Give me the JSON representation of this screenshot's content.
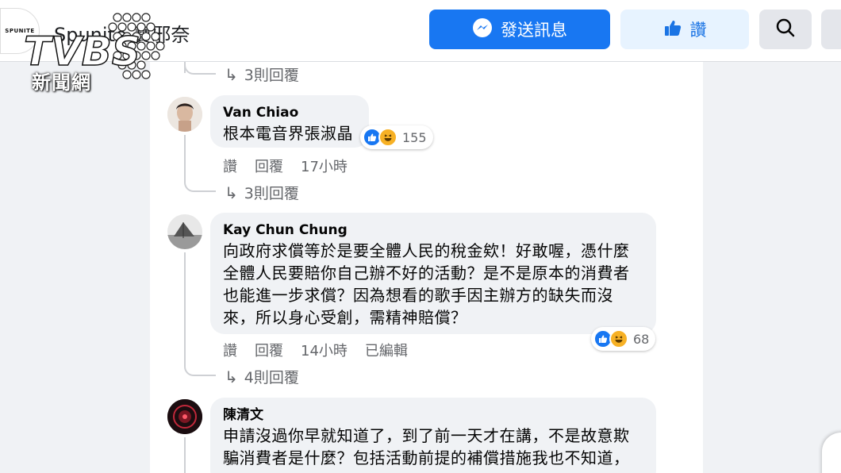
{
  "header": {
    "page_avatar_text": "SPUNITE",
    "page_name": "Spunite 寶邪奈",
    "message_button": "發送訊息",
    "like_button": "讚",
    "search_icon": "search-icon",
    "messenger_icon": "messenger-icon"
  },
  "watermark": {
    "brand": "TVBS",
    "sub": "新聞網"
  },
  "colors": {
    "primary": "#1877f2",
    "like_bg": "#e7f3ff",
    "bubble": "#f0f2f5",
    "secondary_text": "#65676b"
  },
  "top_replies": {
    "label": "3則回覆"
  },
  "comments": [
    {
      "author": "Van Chiao",
      "text": "根本電音界張淑晶",
      "reaction_count": "155",
      "actions": {
        "like": "讚",
        "reply": "回覆",
        "time": "17小時"
      },
      "replies_label": "3則回覆"
    },
    {
      "author": "Kay Chun Chung",
      "text_lines": [
        "向政府求償等於是要全體人民的稅金欸！好敢喔，憑什麼",
        "全體人民要賠你自己辦不好的活動？是不是原本的消費者",
        "也能進一步求償？因為想看的歌手因主辦方的缺失而沒",
        "來，所以身心受創，需精神賠償？"
      ],
      "reaction_count": "68",
      "actions": {
        "like": "讚",
        "reply": "回覆",
        "time": "14小時",
        "edited": "已編輯"
      },
      "replies_label": "4則回覆"
    },
    {
      "author": "陳清文",
      "text_lines": [
        "申請沒過你早就知道了，到了前一天才在講，不是故意欺",
        "騙消費者是什麼？包括活動前提的補償措施我也不知道，"
      ]
    }
  ]
}
